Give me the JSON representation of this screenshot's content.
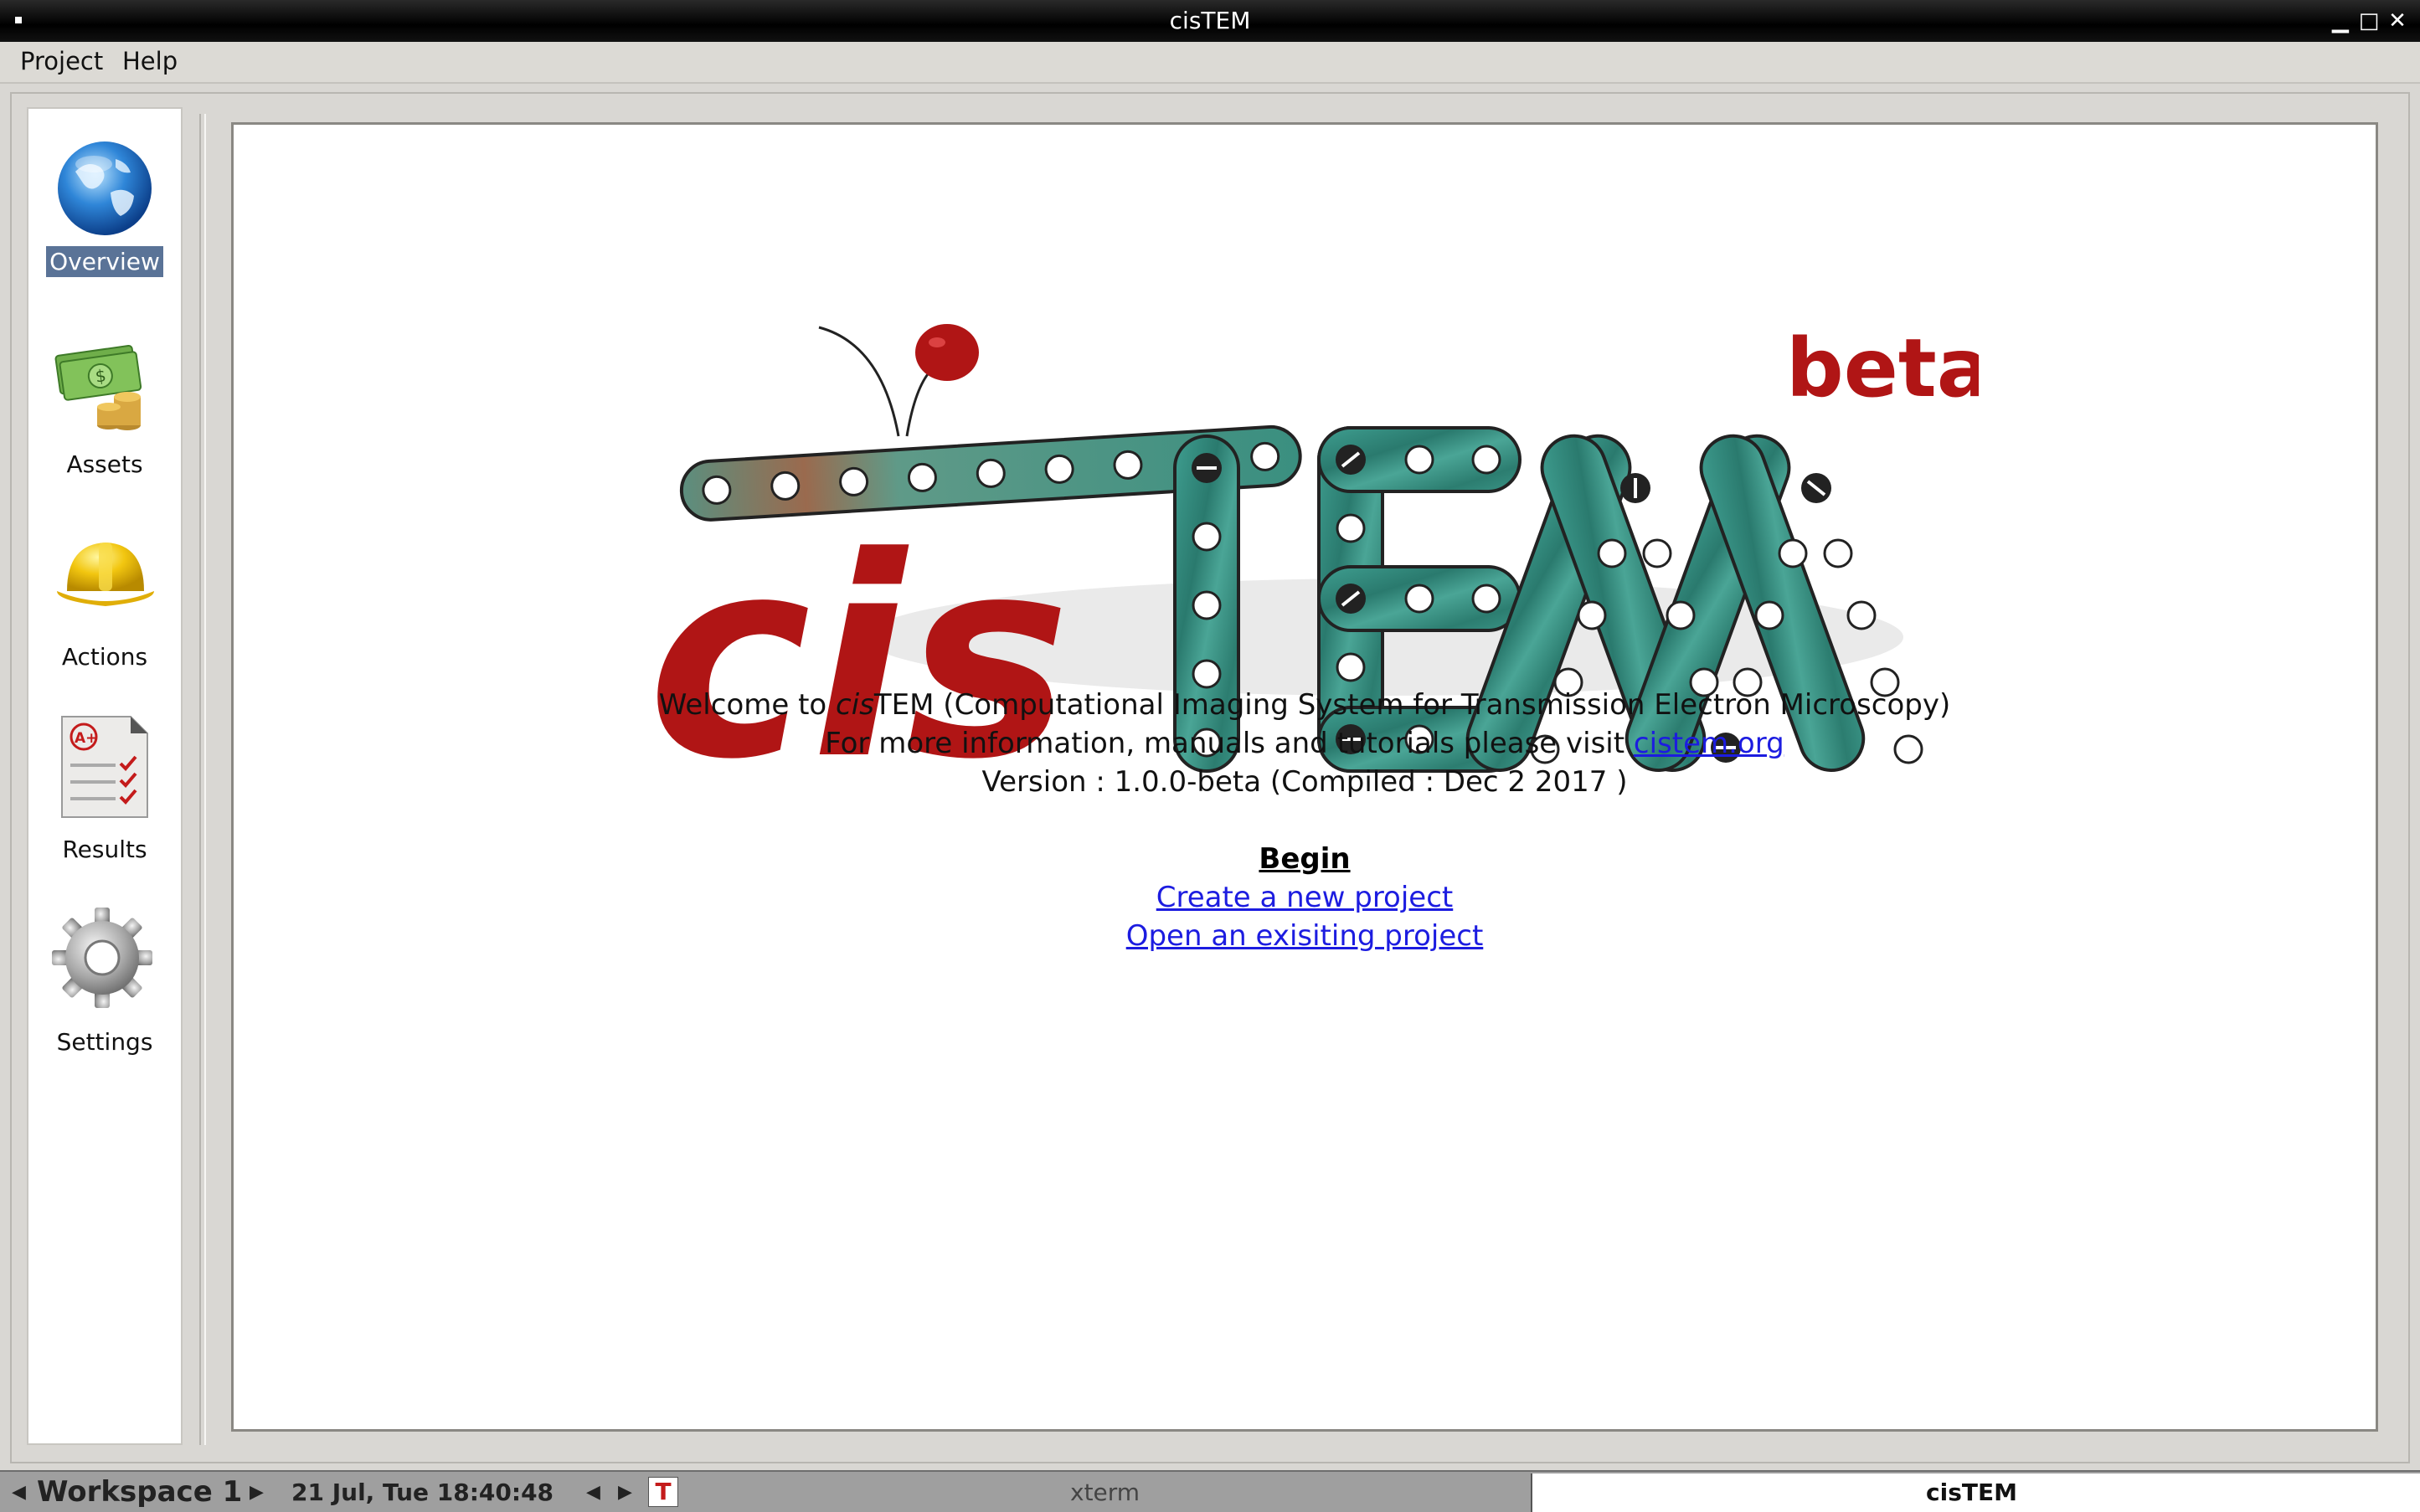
{
  "window": {
    "title": "cisTEM"
  },
  "menu": [
    "Project",
    "Help"
  ],
  "sidebar": {
    "items": [
      {
        "label": "Overview",
        "icon": "globe-icon",
        "selected": true
      },
      {
        "label": "Assets",
        "icon": "money-icon",
        "selected": false
      },
      {
        "label": "Actions",
        "icon": "hardhat-icon",
        "selected": false
      },
      {
        "label": "Results",
        "icon": "checklist-icon",
        "selected": false
      },
      {
        "label": "Settings",
        "icon": "gear-icon",
        "selected": false
      }
    ]
  },
  "logo": {
    "cis": "cis",
    "tem": "TEM",
    "beta": "beta"
  },
  "welcome": {
    "line1_prefix": "Welcome to ",
    "line1_italic": "cis",
    "line1_suffix": "TEM (Computational Imaging System for Transmission Electron Microscopy)",
    "line2_prefix": "For more information, manuals and tutorials please visit ",
    "line2_link": "cistem.org",
    "version": "Version : 1.0.0-beta (Compiled : Dec  2 2017 )",
    "begin": "Begin",
    "create_link": "Create a new project",
    "open_link": "Open an exisiting project"
  },
  "taskbar": {
    "workspace": "Workspace 1",
    "datetime": "21 Jul, Tue 18:40:48",
    "tasks": [
      "xterm",
      "cisTEM"
    ]
  },
  "colors": {
    "accent_red": "#b01515",
    "teal": "#2f8f82",
    "selection": "#5a7397",
    "link": "#1c1ce0"
  }
}
